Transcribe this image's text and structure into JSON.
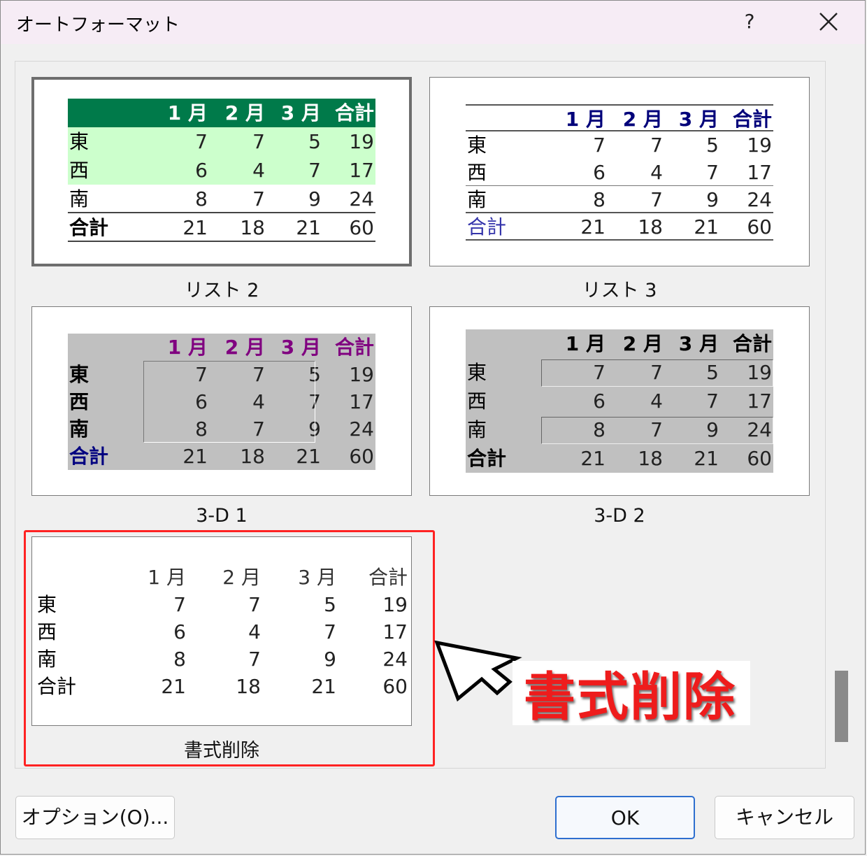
{
  "dialog": {
    "title": "オートフォーマット",
    "help_label": "?",
    "icons": {
      "close": "close-icon",
      "help": "help-icon"
    }
  },
  "formats": [
    {
      "id": "list2",
      "caption": "リスト 2",
      "selected": true,
      "header": [
        "1 月",
        "2 月",
        "3 月",
        "合計"
      ],
      "rows": [
        {
          "label": "東",
          "values": [
            "7",
            "7",
            "5",
            "19"
          ]
        },
        {
          "label": "西",
          "values": [
            "6",
            "4",
            "7",
            "17"
          ]
        },
        {
          "label": "南",
          "values": [
            "8",
            "7",
            "9",
            "24"
          ]
        },
        {
          "label": "合計",
          "values": [
            "21",
            "18",
            "21",
            "60"
          ]
        }
      ],
      "colors": {
        "header_bg": "#007a4a",
        "band_bg": "#ccffcc",
        "header_fg": "#ffffff"
      }
    },
    {
      "id": "list3",
      "caption": "リスト 3",
      "selected": false,
      "header": [
        "1 月",
        "2 月",
        "3 月",
        "合計"
      ],
      "rows": [
        {
          "label": "東",
          "values": [
            "7",
            "7",
            "5",
            "19"
          ]
        },
        {
          "label": "西",
          "values": [
            "6",
            "4",
            "7",
            "17"
          ]
        },
        {
          "label": "南",
          "values": [
            "8",
            "7",
            "9",
            "24"
          ]
        },
        {
          "label": "合計",
          "values": [
            "21",
            "18",
            "21",
            "60"
          ]
        }
      ],
      "colors": {
        "header_fg": "#00007a",
        "total_label_fg": "#3333aa"
      }
    },
    {
      "id": "3d1",
      "caption": "3-D 1",
      "selected": false,
      "header": [
        "1 月",
        "2 月",
        "3 月",
        "合計"
      ],
      "rows": [
        {
          "label": "東",
          "values": [
            "7",
            "7",
            "5",
            "19"
          ]
        },
        {
          "label": "西",
          "values": [
            "6",
            "4",
            "7",
            "17"
          ]
        },
        {
          "label": "南",
          "values": [
            "8",
            "7",
            "9",
            "24"
          ]
        },
        {
          "label": "合計",
          "values": [
            "21",
            "18",
            "21",
            "60"
          ]
        }
      ],
      "colors": {
        "bg": "#c0c0c0",
        "header_fg": "#800080",
        "total_label_fg": "#000080"
      }
    },
    {
      "id": "3d2",
      "caption": "3-D 2",
      "selected": false,
      "header": [
        "1 月",
        "2 月",
        "3 月",
        "合計"
      ],
      "rows": [
        {
          "label": "東",
          "values": [
            "7",
            "7",
            "5",
            "19"
          ]
        },
        {
          "label": "西",
          "values": [
            "6",
            "4",
            "7",
            "17"
          ]
        },
        {
          "label": "南",
          "values": [
            "8",
            "7",
            "9",
            "24"
          ]
        },
        {
          "label": "合計",
          "values": [
            "21",
            "18",
            "21",
            "60"
          ]
        }
      ],
      "colors": {
        "bg": "#c0c0c0"
      }
    },
    {
      "id": "clear",
      "caption": "書式削除",
      "selected": false,
      "header": [
        "1 月",
        "2 月",
        "3 月",
        "合計"
      ],
      "rows": [
        {
          "label": "東",
          "values": [
            "7",
            "7",
            "5",
            "19"
          ]
        },
        {
          "label": "西",
          "values": [
            "6",
            "4",
            "7",
            "17"
          ]
        },
        {
          "label": "南",
          "values": [
            "8",
            "7",
            "9",
            "24"
          ]
        },
        {
          "label": "合計",
          "values": [
            "21",
            "18",
            "21",
            "60"
          ]
        }
      ]
    }
  ],
  "annotation": {
    "callout_text": "書式削除",
    "highlight_color": "#ff2222",
    "arrow": "pointer-arrow-icon"
  },
  "buttons": {
    "options": "オプション(O)...",
    "ok": "OK",
    "cancel": "キャンセル"
  }
}
